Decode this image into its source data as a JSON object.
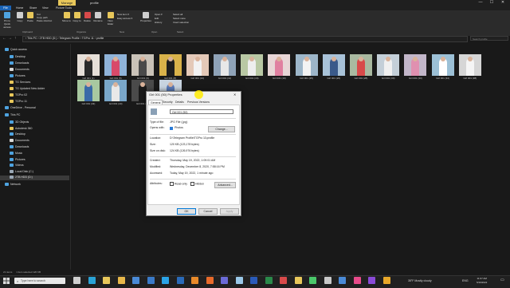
{
  "window": {
    "manage_label": "Manage",
    "title": "profile",
    "minimize": "—",
    "maximize": "☐",
    "close": "✕"
  },
  "ribbon_tabs": [
    "File",
    "Home",
    "Share",
    "View",
    "Picture Tools"
  ],
  "ribbon": {
    "pin": "Pin to Quick access",
    "copy": "Copy",
    "paste": "Paste",
    "cut": "Cut",
    "copy_path": "Copy path",
    "paste_shortcut": "Paste shortcut",
    "move_to": "Move to",
    "copy_to": "Copy to",
    "delete": "Delete",
    "rename": "Rename",
    "new_folder": "New folder",
    "new_item": "New item ▾",
    "easy_access": "Easy access ▾",
    "properties": "Properties",
    "open": "Open ▾",
    "edit": "Edit",
    "history": "History",
    "select_all": "Select all",
    "select_none": "Select none",
    "invert_selection": "Invert selection",
    "groups": [
      "Clipboard",
      "Organize",
      "New",
      "Open",
      "Select"
    ]
  },
  "address": {
    "path": "›  This PC  ›  2TB HDD (D:)  ›  Telegram Profile  ›  TGPro 11  ›  profile",
    "search_placeholder": "Search profile"
  },
  "sidebar": {
    "items": [
      {
        "label": "Quick access",
        "icon": "star-icon",
        "color": "#4ea3e0",
        "indent": 0
      },
      {
        "label": "Desktop",
        "icon": "desktop-icon",
        "color": "#4ea3e0",
        "indent": 1
      },
      {
        "label": "Downloads",
        "icon": "download-icon",
        "color": "#4ea3e0",
        "indent": 1
      },
      {
        "label": "Documents",
        "icon": "document-icon",
        "color": "#d8d8d8",
        "indent": 1
      },
      {
        "label": "Pictures",
        "icon": "pictures-icon",
        "color": "#4ea3e0",
        "indent": 1
      },
      {
        "label": "TG Services",
        "icon": "folder-icon",
        "color": "#e8c75a",
        "indent": 1
      },
      {
        "label": "TG Updated New Adder",
        "icon": "folder-icon",
        "color": "#e8c75a",
        "indent": 1
      },
      {
        "label": "TGPro 02",
        "icon": "folder-icon",
        "color": "#e8c75a",
        "indent": 1
      },
      {
        "label": "TGPro 11",
        "icon": "folder-icon",
        "color": "#e8c75a",
        "indent": 1
      },
      {
        "label": "OneDrive - Personal",
        "icon": "cloud-icon",
        "color": "#4ea3e0",
        "indent": 0
      },
      {
        "label": "This PC",
        "icon": "computer-icon",
        "color": "#4ea3e0",
        "indent": 0
      },
      {
        "label": "3D Objects",
        "icon": "cube-icon",
        "color": "#4ea3e0",
        "indent": 1
      },
      {
        "label": "Autodesk 360",
        "icon": "folder-icon",
        "color": "#e8c75a",
        "indent": 1
      },
      {
        "label": "Desktop",
        "icon": "desktop-icon",
        "color": "#4ea3e0",
        "indent": 1
      },
      {
        "label": "Documents",
        "icon": "document-icon",
        "color": "#d8d8d8",
        "indent": 1
      },
      {
        "label": "Downloads",
        "icon": "download-icon",
        "color": "#4ea3e0",
        "indent": 1
      },
      {
        "label": "Music",
        "icon": "music-icon",
        "color": "#4ea3e0",
        "indent": 1
      },
      {
        "label": "Pictures",
        "icon": "pictures-icon",
        "color": "#4ea3e0",
        "indent": 1
      },
      {
        "label": "Videos",
        "icon": "video-icon",
        "color": "#4ea3e0",
        "indent": 1
      },
      {
        "label": "Local Disk (C:)",
        "icon": "drive-icon",
        "color": "#9aa8b6",
        "indent": 1
      },
      {
        "label": "2TB HDD (D:)",
        "icon": "drive-icon",
        "color": "#9aa8b6",
        "indent": 1,
        "selected": true
      },
      {
        "label": "Network",
        "icon": "network-icon",
        "color": "#4ea3e0",
        "indent": 0
      }
    ]
  },
  "files": [
    {
      "name": "Girl 001 (1)",
      "bg": "#e6dfd8",
      "fig": "#2a2a2a"
    },
    {
      "name": "Girl 001 (5)",
      "bg": "#8fb3d9",
      "fig": "#d84a6a"
    },
    {
      "name": "Girl 001 (6)",
      "bg": "#c9c2b8",
      "fig": "#4a4a4a"
    },
    {
      "name": "Girl 001 (8)",
      "bg": "#d9b24a",
      "fig": "#1e1e1e"
    },
    {
      "name": "Girl 001 (10)",
      "bg": "#e4c9b8",
      "fig": "#f2f2f2"
    },
    {
      "name": "Girl 001 (11)",
      "bg": "#8fa3b8",
      "fig": "#e8e8e8"
    },
    {
      "name": "Girl 001 (16)",
      "bg": "#b9c8a4",
      "fig": "#eeeeee"
    },
    {
      "name": "Girl 001 (19)",
      "bg": "#e8d6d6",
      "fig": "#e080a0"
    },
    {
      "name": "Girl 001 (25)",
      "bg": "#9db6c9",
      "fig": "#f3f3f3"
    },
    {
      "name": "Girl 001 (26)",
      "bg": "#a8c2d8",
      "fig": "#3a5a8a"
    },
    {
      "name": "Girl 001 (28)",
      "bg": "#a9b9a0",
      "fig": "#d84a4a"
    },
    {
      "name": "Girl 001 (30)",
      "bg": "#c4cfd8",
      "fig": "#f0f0f0"
    },
    {
      "name": "Girl 001 (33)",
      "bg": "#c2b6c9",
      "fig": "#e090b0"
    },
    {
      "name": "Girl 001 (34)",
      "bg": "#9cc0d6",
      "fig": "#ffffff"
    },
    {
      "name": "Girl 001 (38)",
      "bg": "#d6d6d6",
      "fig": "#f5f5f5"
    },
    {
      "name": "Girl 001 (43)",
      "bg": "#a8c8a0",
      "fig": "#3a6aa8"
    },
    {
      "name": "Girl 001 (44)",
      "bg": "#7aa7c9",
      "fig": "#e8e8e8"
    },
    {
      "name": "Girl 001 (45)",
      "bg": "#4a4a4a",
      "fig": "#1a1a1a"
    },
    {
      "name": "Girl 001 (50)",
      "bg": "#c8d4e0",
      "fig": "#5a7ab8"
    }
  ],
  "status": {
    "items": "21 items",
    "selected": "1 item selected  120 KB"
  },
  "dialog": {
    "title": "Girl 001 (50) Properties",
    "close": "✕",
    "tabs": [
      "General",
      "Security",
      "Details",
      "Previous Versions"
    ],
    "filename": "Girl 001 (50)",
    "type_label": "Type of file:",
    "type_value": "JPG File (.jpg)",
    "opens_label": "Opens with:",
    "opens_value": "Photos",
    "change_button": "Change...",
    "location_label": "Location:",
    "location_value": "D:\\Telegram Profile\\TGPro 11\\profile",
    "size_label": "Size:",
    "size_value": "120 KB (123,178 bytes)",
    "size_disk_label": "Size on disk:",
    "size_disk_value": "124 KB (126,976 bytes)",
    "created_label": "Created:",
    "created_value": "Thursday, May 19, 2022, 1:09:01 AM",
    "modified_label": "Modified:",
    "modified_value": "Wednesday, December 8, 2020, 7:58:16 PM",
    "accessed_label": "Accessed:",
    "accessed_value": "Today, May 19, 2022, 1 minute ago",
    "attributes_label": "Attributes:",
    "readonly_label": "Read-only",
    "hidden_label": "Hidden",
    "advanced_button": "Advanced...",
    "ok_button": "OK",
    "cancel_button": "Cancel",
    "apply_button": "Apply"
  },
  "taskbar": {
    "search_placeholder": "Type here to search",
    "weather": "35°F  Mostly cloudy",
    "lang": "ENG",
    "time": "11:07 AM",
    "date": "5/19/2022",
    "apps": [
      {
        "name": "task-view-icon",
        "color": "#cfcfcf"
      },
      {
        "name": "edge-icon",
        "color": "#2aa3d6"
      },
      {
        "name": "chrome-icon",
        "color": "#e8c75a"
      },
      {
        "name": "explorer-icon",
        "color": "#e8b84a"
      },
      {
        "name": "store-icon",
        "color": "#4a8ad6"
      },
      {
        "name": "mail-icon",
        "color": "#3a7ac8"
      },
      {
        "name": "telegram-icon",
        "color": "#2aa3e6"
      },
      {
        "name": "photoshop-icon",
        "color": "#2a6ab8"
      },
      {
        "name": "vlc-icon",
        "color": "#e88a2a"
      },
      {
        "name": "firefox-icon",
        "color": "#e86a2a"
      },
      {
        "name": "teams-icon",
        "color": "#6a6ad6"
      },
      {
        "name": "notepad-icon",
        "color": "#9ac8e8"
      },
      {
        "name": "word-icon",
        "color": "#2a5ab8"
      },
      {
        "name": "excel-icon",
        "color": "#2a8a4a"
      },
      {
        "name": "app-icon",
        "color": "#d84a4a"
      },
      {
        "name": "app-icon",
        "color": "#e8c75a"
      },
      {
        "name": "app-icon",
        "color": "#4ac86a"
      },
      {
        "name": "app-icon",
        "color": "#c8c8c8"
      },
      {
        "name": "app-icon",
        "color": "#4a8ad6"
      },
      {
        "name": "app-icon",
        "color": "#e84a8a"
      },
      {
        "name": "app-icon",
        "color": "#8a4ad6"
      },
      {
        "name": "app-icon",
        "color": "#e8a82a"
      }
    ]
  }
}
